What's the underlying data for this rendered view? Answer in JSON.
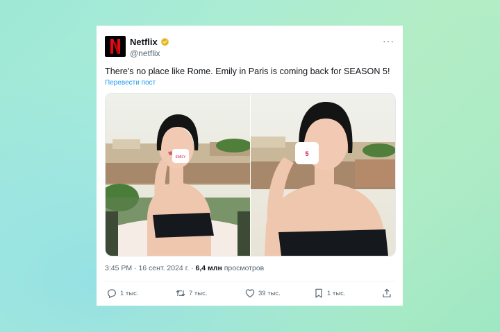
{
  "tweet": {
    "author_name": "Netflix",
    "author_handle": "@netflix",
    "text": "There's no place like Rome. Emily in Paris is coming back for SEASON 5!",
    "translate_label": "Перевести пост",
    "time": "3:45 PM",
    "date": "16 сент. 2024 г.",
    "separator": "·",
    "views_count": "6,4 млн",
    "views_label": "просмотров",
    "more_label": "···"
  },
  "actions": {
    "reply_count": "1 тыс.",
    "retweet_count": "7 тыс.",
    "like_count": "39 тыс.",
    "bookmark_count": "1 тыс."
  },
  "media": {
    "photos": [
      {
        "id": "photo-left",
        "cup_text": "EMILY IN PARIS"
      },
      {
        "id": "photo-right",
        "cup_text": "5"
      }
    ]
  },
  "icons": {
    "avatar": "netflix-logo-icon",
    "verified": "verified-badge-icon",
    "more": "more-icon",
    "reply": "reply-icon",
    "retweet": "retweet-icon",
    "like": "like-icon",
    "bookmark": "bookmark-icon",
    "share": "share-icon"
  },
  "colors": {
    "brand_red": "#e50914",
    "link_blue": "#1d9bf0",
    "verified_gold": "#e2b719",
    "text_primary": "#0f1419",
    "text_secondary": "#536471"
  }
}
